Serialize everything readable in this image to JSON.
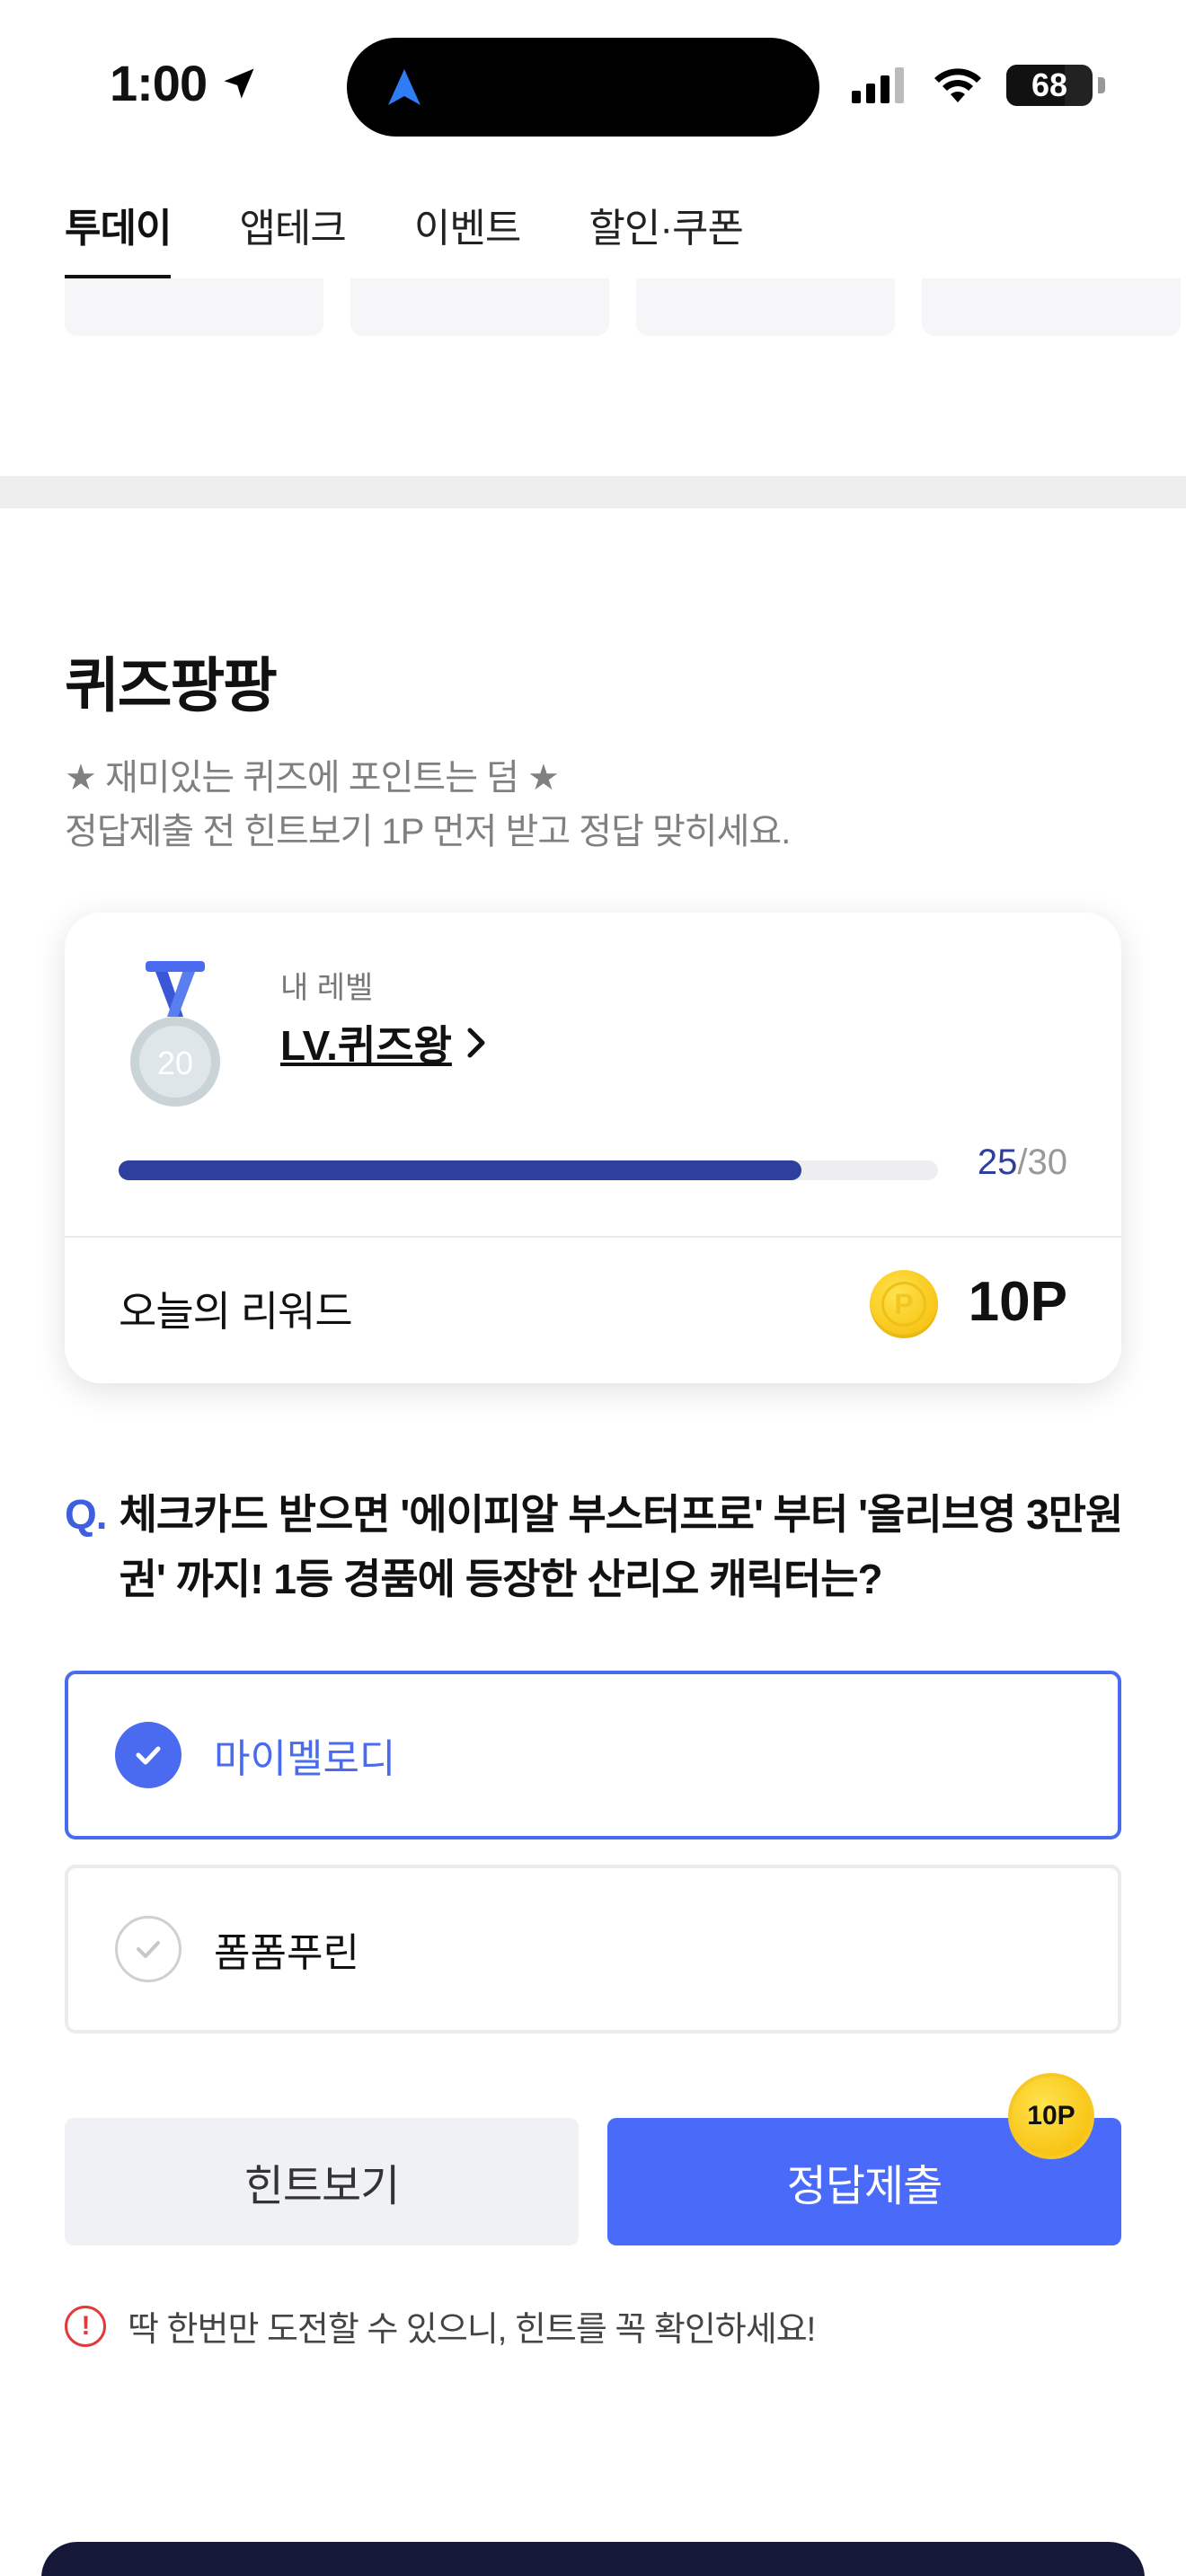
{
  "status": {
    "time": "1:00",
    "battery": "68"
  },
  "tabs": [
    {
      "label": "투데이",
      "active": true
    },
    {
      "label": "앱테크",
      "active": false
    },
    {
      "label": "이벤트",
      "active": false
    },
    {
      "label": "할인·쿠폰",
      "active": false
    }
  ],
  "quiz": {
    "title": "퀴즈팡팡",
    "desc_line1": "★ 재미있는 퀴즈에 포인트는 덤 ★",
    "desc_line2": "정답제출 전 힌트보기 1P 먼저 받고 정답 맞히세요."
  },
  "level": {
    "label": "내 레벨",
    "name": "LV.퀴즈왕",
    "medal_number": "20",
    "progress_current": "25",
    "progress_total": "/30",
    "progress_fraction": 0.833
  },
  "reward": {
    "label": "오늘의 리워드",
    "coin_letter": "P",
    "value": "10P"
  },
  "question": {
    "prefix": "Q.",
    "text": "체크카드 받으면 '에이피알 부스터프로' 부터 '올리브영 3만원권' 까지! 1등 경품에 등장한 산리오 캐릭터는?"
  },
  "options": [
    {
      "label": "마이멜로디",
      "selected": true
    },
    {
      "label": "폼폼푸린",
      "selected": false
    }
  ],
  "buttons": {
    "hint": "힌트보기",
    "submit": "정답제출",
    "submit_badge": "10P"
  },
  "warning": {
    "icon": "!",
    "text": "딱 한번만 도전할 수 있으니, 힌트를 꼭 확인하세요!"
  },
  "colors": {
    "accent": "#4a6bfa",
    "progress": "#2e3f9e",
    "warning": "#e23a3a",
    "coin": "#f5b800"
  }
}
